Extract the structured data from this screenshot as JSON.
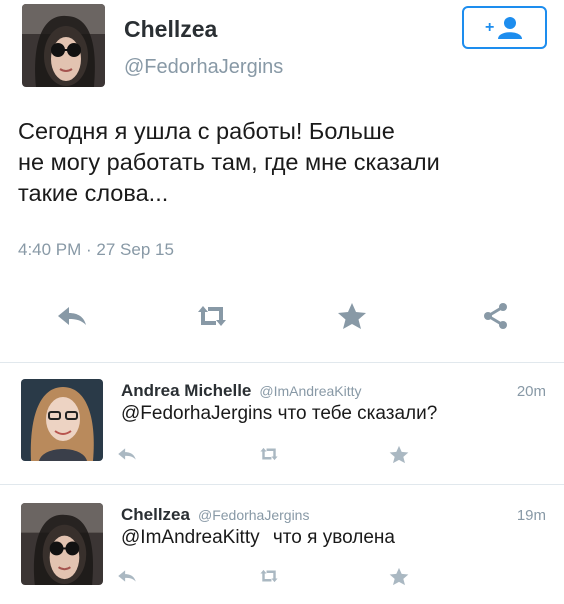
{
  "main_tweet": {
    "display_name": "Chellzea",
    "handle": "@FedorhaJergins",
    "text_lines": [
      "Сегодня я ушла с работы! Больше",
      "не могу работать там, где мне сказали",
      "такие слова..."
    ],
    "timestamp": "4:40 PM · 27 Sep 15",
    "follow_icon": "add-user-icon"
  },
  "replies": [
    {
      "display_name": "Andrea Michelle",
      "handle": "@ImAndreaKitty",
      "time": "20m",
      "mention": "@FedorhaJergins",
      "text": "что тебе сказали?"
    },
    {
      "display_name": "Chellzea",
      "handle": "@FedorhaJergins",
      "time": "19m",
      "mention": "@ImAndreaKitty",
      "text": "что я уволена"
    }
  ],
  "icons": [
    "reply-icon",
    "retweet-icon",
    "favorite-star-icon",
    "share-icon"
  ],
  "colors": {
    "accent": "#1d8dee",
    "icon_gray": "#8899a6",
    "star_gray": "#aab8c2"
  }
}
